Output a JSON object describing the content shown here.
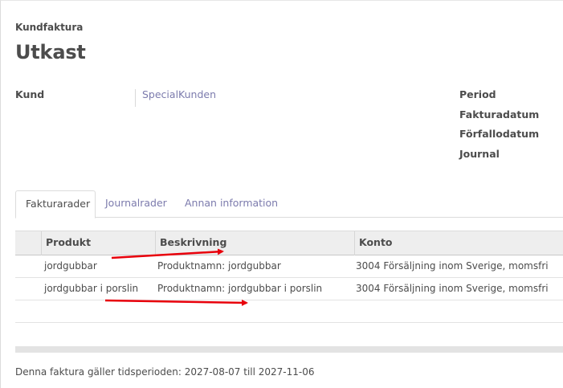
{
  "header": {
    "doc_type": "Kundfaktura",
    "state": "Utkast"
  },
  "customer": {
    "label": "Kund",
    "value": "SpecialKunden"
  },
  "info_fields": [
    {
      "label": "Period"
    },
    {
      "label": "Fakturadatum"
    },
    {
      "label": "Förfallodatum"
    },
    {
      "label": "Journal"
    }
  ],
  "tabs": [
    {
      "label": "Fakturarader",
      "active": true
    },
    {
      "label": "Journalrader",
      "active": false
    },
    {
      "label": "Annan information",
      "active": false
    }
  ],
  "grid": {
    "columns": [
      "Produkt",
      "Beskrivning",
      "Konto"
    ],
    "rows": [
      {
        "product": "jordgubbar",
        "description": "Produktnamn:  jordgubbar",
        "account": "3004 Försäljning inom Sverige, momsfri"
      },
      {
        "product": "jordgubbar i porslin",
        "description": "Produktnamn:  jordgubbar i porslin",
        "account": "3004 Försäljning inom Sverige, momsfri"
      }
    ]
  },
  "footer": {
    "period_note": "Denna faktura gäller tidsperioden: 2027-08-07 till 2027-11-06"
  },
  "colors": {
    "link": "#7c7bad",
    "annotation_arrow": "#e8000b"
  }
}
